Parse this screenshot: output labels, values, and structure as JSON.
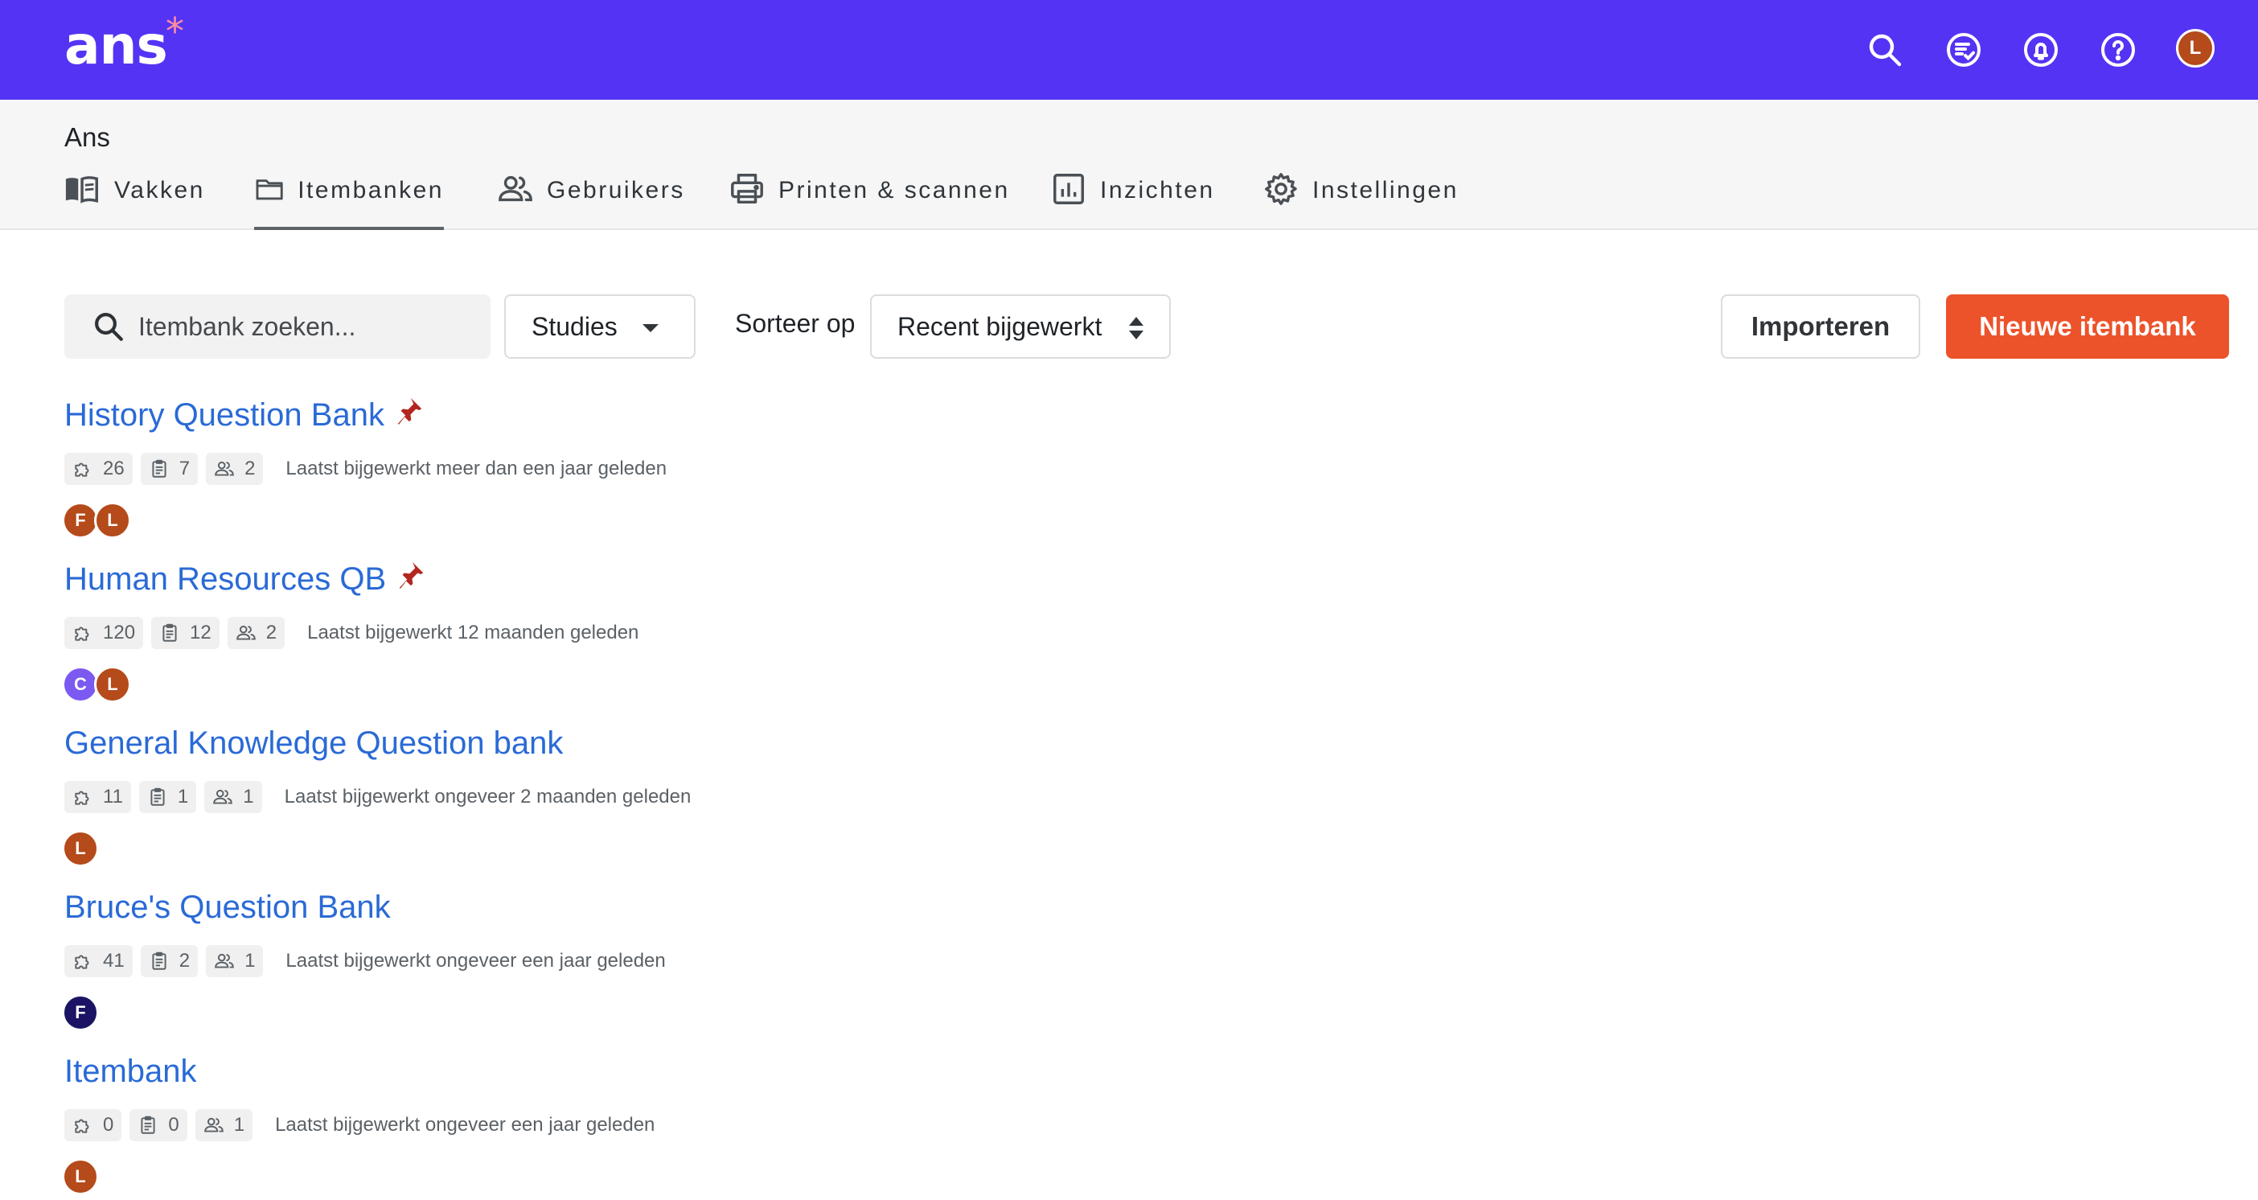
{
  "app": {
    "logo_text": "ans",
    "logo_mark": "*",
    "user_initial": "L",
    "brand_color": "#5533f4",
    "accent_color": "#ec532a",
    "link_color": "#2a6ad6"
  },
  "topbar_icons": [
    "search-icon",
    "tasks-icon",
    "notifications-icon",
    "help-icon"
  ],
  "org": {
    "name": "Ans"
  },
  "tabs": [
    {
      "label": "Vakken",
      "icon": "book-icon",
      "active": false
    },
    {
      "label": "Itembanken",
      "icon": "folder-icon",
      "active": true
    },
    {
      "label": "Gebruikers",
      "icon": "users-icon",
      "active": false
    },
    {
      "label": "Printen & scannen",
      "icon": "printer-icon",
      "active": false
    },
    {
      "label": "Inzichten",
      "icon": "chart-icon",
      "active": false
    },
    {
      "label": "Instellingen",
      "icon": "gear-icon",
      "active": false
    }
  ],
  "toolbar": {
    "search_placeholder": "Itembank zoeken...",
    "filter_value": "Studies",
    "sort_label": "Sorteer op",
    "sort_value": "Recent bijgewerkt",
    "import_label": "Importeren",
    "new_label": "Nieuwe itembank"
  },
  "banks": [
    {
      "title": "History Question Bank",
      "pinned": true,
      "items": "26",
      "assessments": "7",
      "users": "2",
      "updated": "Laatst bijgewerkt meer dan een jaar geleden",
      "avatars": [
        {
          "initial": "F",
          "color": "#b54a1a"
        },
        {
          "initial": "L",
          "color": "#b54a1a"
        }
      ]
    },
    {
      "title": "Human Resources QB",
      "pinned": true,
      "items": "120",
      "assessments": "12",
      "users": "2",
      "updated": "Laatst bijgewerkt 12 maanden geleden",
      "avatars": [
        {
          "initial": "C",
          "color": "#7a5af0"
        },
        {
          "initial": "L",
          "color": "#b54a1a"
        }
      ]
    },
    {
      "title": "General Knowledge Question bank",
      "pinned": false,
      "items": "11",
      "assessments": "1",
      "users": "1",
      "updated": "Laatst bijgewerkt ongeveer 2 maanden geleden",
      "avatars": [
        {
          "initial": "L",
          "color": "#b54a1a"
        }
      ]
    },
    {
      "title": "Bruce's Question Bank",
      "pinned": false,
      "items": "41",
      "assessments": "2",
      "users": "1",
      "updated": "Laatst bijgewerkt ongeveer een jaar geleden",
      "avatars": [
        {
          "initial": "F",
          "color": "#1b1464"
        }
      ]
    },
    {
      "title": "Itembank",
      "pinned": false,
      "items": "0",
      "assessments": "0",
      "users": "1",
      "updated": "Laatst bijgewerkt ongeveer een jaar geleden",
      "avatars": [
        {
          "initial": "L",
          "color": "#b54a1a"
        }
      ]
    }
  ]
}
